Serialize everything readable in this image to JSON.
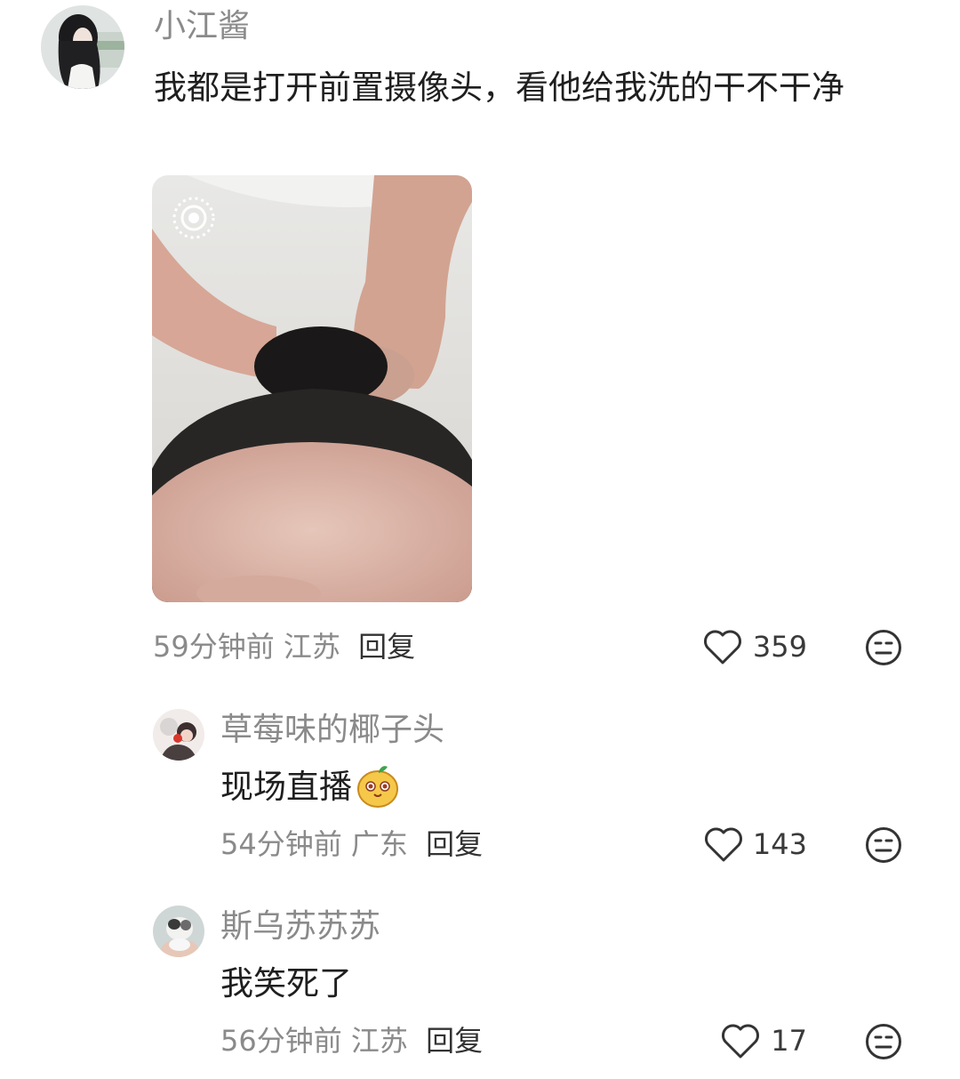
{
  "comments": [
    {
      "username": "小江酱",
      "text": "我都是打开前置摄像头，看他给我洗的干不干净",
      "time": "59分钟前",
      "location": "江苏",
      "reply_label": "回复",
      "likes": "359"
    },
    {
      "username": "草莓味的椰子头",
      "text": "现场直播",
      "time": "54分钟前",
      "location": "广东",
      "reply_label": "回复",
      "likes": "143"
    },
    {
      "username": "斯乌苏苏苏",
      "text": "我笑死了",
      "time": "56分钟前",
      "location": "江苏",
      "reply_label": "回复",
      "likes": "17"
    }
  ],
  "icons": {
    "like": "heart-outline-icon",
    "reaction": "neutral-face-icon",
    "live_photo": "live-photo-icon",
    "emoji": "mango-sticker-emoji"
  }
}
